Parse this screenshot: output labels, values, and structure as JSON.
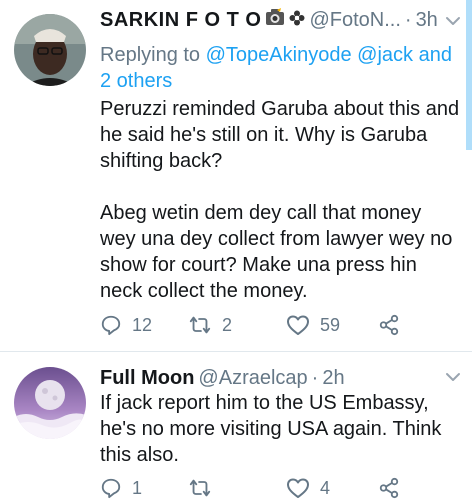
{
  "tweets": [
    {
      "name": "SARKIN F O T O",
      "handle": "@FotoN...",
      "separator": "·",
      "time": "3h",
      "reply_prefix": "Replying to ",
      "reply_mention_1": "@TopeAkinyode",
      "reply_mention_2": "@jack",
      "reply_and": " and ",
      "reply_others": "2 others",
      "body": [
        "Peruzzi reminded Garuba about this and he said he's still on it. Why is Garuba shifting back?",
        "Abeg wetin dem dey call that money wey una dey collect from lawyer wey no show for court? Make una press hin neck collect the money."
      ],
      "replies": "12",
      "retweets": "2",
      "likes": "59"
    },
    {
      "name": "Full Moon",
      "handle": "@Azraelcap",
      "separator": "·",
      "time": "2h",
      "body": [
        "If jack report him to the US Embassy, he's no more visiting USA again. Think this also."
      ],
      "replies": "1",
      "retweets": "",
      "likes": "4"
    }
  ],
  "icons": {
    "reply": "reply-icon",
    "retweet": "retweet-icon",
    "like": "heart-icon",
    "share": "share-icon",
    "camera": "camera-emoji-icon",
    "flower": "flower-emoji-icon",
    "chevron": "chevron-down-icon"
  },
  "colors": {
    "link": "#1da1f2",
    "secondary": "#657786",
    "text": "#14171a",
    "divider": "#e1e8ed"
  }
}
